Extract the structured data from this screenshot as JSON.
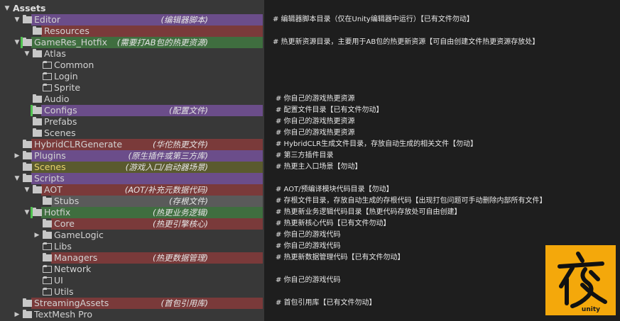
{
  "colors": {
    "purple": "#6b4d8a",
    "green": "#3f6e3f",
    "red": "#7a3a3a",
    "gray": "#5a5a5a",
    "logo_bg": "#f4a80b"
  },
  "tree": [
    {
      "depth": 0,
      "arrow": "down",
      "folder": "none",
      "name": "Assets",
      "bold": true
    },
    {
      "depth": 1,
      "arrow": "down",
      "folder": "filled",
      "name": "Editor",
      "hl": "purple",
      "ann": "(编辑器脚本)"
    },
    {
      "depth": 2,
      "arrow": "none",
      "folder": "filled",
      "name": "Resources",
      "hl": "red"
    },
    {
      "depth": 1,
      "arrow": "down",
      "folder": "filled",
      "name": "GameRes_Hotfix",
      "hl": "green",
      "bar": true,
      "ann": "(需要打AB包的热更资源)"
    },
    {
      "depth": 2,
      "arrow": "down",
      "folder": "filled",
      "name": "Atlas"
    },
    {
      "depth": 3,
      "arrow": "none",
      "folder": "outline",
      "name": "Common"
    },
    {
      "depth": 3,
      "arrow": "none",
      "folder": "outline",
      "name": "Login"
    },
    {
      "depth": 3,
      "arrow": "none",
      "folder": "outline",
      "name": "Sprite"
    },
    {
      "depth": 2,
      "arrow": "none",
      "folder": "filled",
      "name": "Audio"
    },
    {
      "depth": 2,
      "arrow": "none",
      "folder": "filled",
      "name": "Configs",
      "hl": "purple",
      "bar": true,
      "ann": "(配置文件)"
    },
    {
      "depth": 2,
      "arrow": "none",
      "folder": "filled",
      "name": "Prefabs"
    },
    {
      "depth": 2,
      "arrow": "none",
      "folder": "filled",
      "name": "Scenes"
    },
    {
      "depth": 1,
      "arrow": "none",
      "folder": "filled",
      "name": "HybridCLRGenerate",
      "hl": "red",
      "ann": "(华佗热更文件)"
    },
    {
      "depth": 1,
      "arrow": "right",
      "folder": "filled",
      "name": "Plugins",
      "hl": "purple",
      "ann": "(原生插件或第三方库)"
    },
    {
      "depth": 1,
      "arrow": "none",
      "folder": "filled",
      "name": "Scenes",
      "hl": "olive",
      "ann": "(游戏入口/启动器场景)"
    },
    {
      "depth": 1,
      "arrow": "down",
      "folder": "filled",
      "name": "Scripts",
      "hl": "purple"
    },
    {
      "depth": 2,
      "arrow": "down",
      "folder": "filled",
      "name": "AOT",
      "hl": "red",
      "ann": "(AOT/补充元数据代码)"
    },
    {
      "depth": 3,
      "arrow": "none",
      "folder": "filled",
      "name": "Stubs",
      "hl": "gray",
      "ann": "(存根文件)"
    },
    {
      "depth": 2,
      "arrow": "down",
      "folder": "filled",
      "name": "Hotfix",
      "hl": "green",
      "bar": true,
      "ann": "(热更业务逻辑)"
    },
    {
      "depth": 3,
      "arrow": "none",
      "folder": "filled",
      "name": "Core",
      "hl": "red",
      "ann": "(热更引擎核心)"
    },
    {
      "depth": 3,
      "arrow": "right",
      "folder": "filled",
      "name": "GameLogic"
    },
    {
      "depth": 3,
      "arrow": "none",
      "folder": "outline",
      "name": "Libs"
    },
    {
      "depth": 3,
      "arrow": "none",
      "folder": "filled",
      "name": "Managers",
      "hl": "red",
      "ann": "(热更数据管理)"
    },
    {
      "depth": 3,
      "arrow": "none",
      "folder": "outline",
      "name": "Network"
    },
    {
      "depth": 3,
      "arrow": "none",
      "folder": "outline",
      "name": "UI"
    },
    {
      "depth": 3,
      "arrow": "none",
      "folder": "outline",
      "name": "Utils"
    },
    {
      "depth": 1,
      "arrow": "none",
      "folder": "filled",
      "name": "StreamingAssets",
      "hl": "red",
      "ann": "(首包引用库)"
    },
    {
      "depth": 1,
      "arrow": "right",
      "folder": "filled",
      "name": "TextMesh Pro"
    }
  ],
  "notes": [
    {
      "row": 1,
      "text": "# 编辑器脚本目录（仅在Unity编辑器中运行）【已有文件勿动】"
    },
    {
      "row": 3,
      "text": "# 热更新资源目录，主要用于AB包的热更新资源【可自由创建文件热更资源存放处】"
    },
    {
      "row": 8,
      "text": "# 你自己的游戏热更资源"
    },
    {
      "row": 9,
      "text": "# 配置文件目录【已有文件勿动】"
    },
    {
      "row": 10,
      "text": "# 你自己的游戏热更资源"
    },
    {
      "row": 11,
      "text": "# 你自己的游戏热更资源"
    },
    {
      "row": 12,
      "text": "# HybridCLR生成文件目录，存放自动生成的相关文件【勿动】"
    },
    {
      "row": 13,
      "text": "# 第三方插件目录"
    },
    {
      "row": 14,
      "text": "# 热更主入口场景【勿动】"
    },
    {
      "row": 16,
      "text": "# AOT/预编译模块代码目录【勿动】"
    },
    {
      "row": 17,
      "text": "# 存根文件目录，存放自动生成的存根代码【出现打包问题可手动删除内部所有文件】"
    },
    {
      "row": 18,
      "text": "# 热更新业务逻辑代码目录【热更代码存放处可自由创建】"
    },
    {
      "row": 19,
      "text": "# 热更新核心代码【已有文件勿动】"
    },
    {
      "row": 20,
      "text": "# 你自己的游戏代码"
    },
    {
      "row": 21,
      "text": "# 你自己的游戏代码"
    },
    {
      "row": 22,
      "text": "# 热更新数据管理代码【已有文件勿动】"
    },
    {
      "row": 24,
      "text": "# 你自己的游戏代码"
    },
    {
      "row": 26,
      "text": "# 首包引用库【已有文件勿动】"
    }
  ],
  "logo": {
    "glyph": "夜",
    "brand": "unity"
  }
}
